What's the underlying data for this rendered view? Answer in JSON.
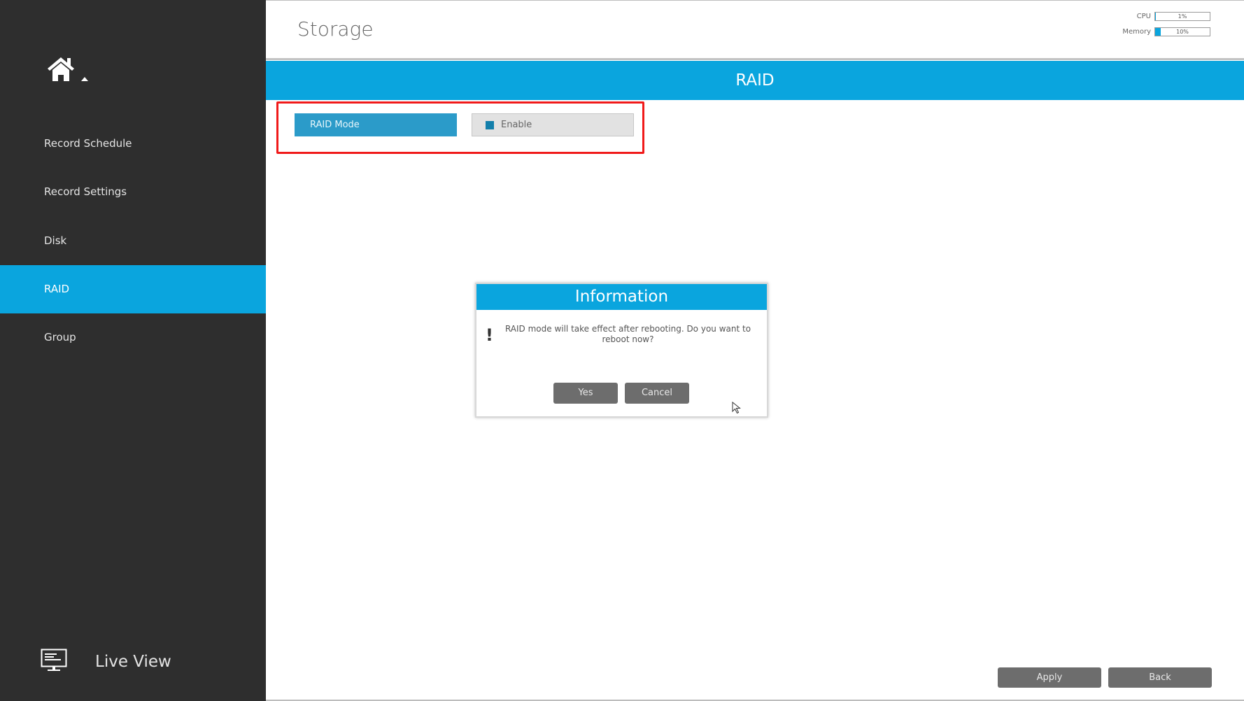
{
  "sidebar": {
    "home_icon": "home-icon",
    "items": [
      {
        "label": "Record Schedule",
        "active": false
      },
      {
        "label": "Record Settings",
        "active": false
      },
      {
        "label": "Disk",
        "active": false
      },
      {
        "label": "RAID",
        "active": true
      },
      {
        "label": "Group",
        "active": false
      }
    ],
    "live_view": {
      "label": "Live View",
      "icon": "monitor-icon"
    }
  },
  "header": {
    "title": "Storage",
    "meters": [
      {
        "label": "CPU",
        "value_text": "1%",
        "percent": 1
      },
      {
        "label": "Memory",
        "value_text": "10%",
        "percent": 10
      }
    ]
  },
  "banner": {
    "title": "RAID"
  },
  "form": {
    "raid_mode": {
      "label": "RAID Mode",
      "checkbox_label": "Enable",
      "checked": true
    }
  },
  "dialog": {
    "title": "Information",
    "icon": "exclamation-icon",
    "message": "RAID mode will take effect after rebooting. Do you want to reboot now?",
    "buttons": {
      "yes": "Yes",
      "cancel": "Cancel"
    }
  },
  "footer": {
    "apply": "Apply",
    "back": "Back"
  },
  "colors": {
    "accent": "#0aa5de",
    "sidebar_bg": "#2e2e2e",
    "button_bg": "#6d6d6d",
    "highlight": "#f01a1a"
  }
}
